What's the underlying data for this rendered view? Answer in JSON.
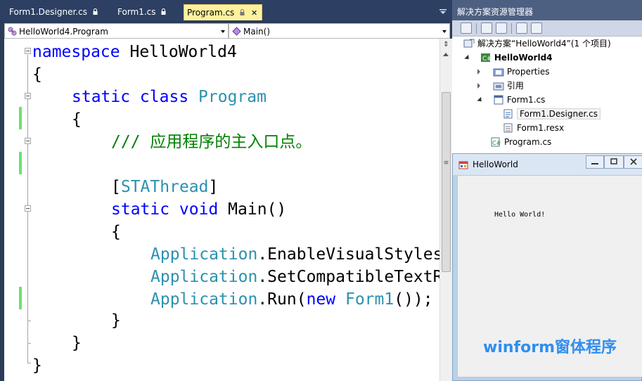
{
  "tabs": [
    {
      "label": "Form1.Designer.cs",
      "active": false
    },
    {
      "label": "Form1.cs",
      "active": false
    },
    {
      "label": "Program.cs",
      "active": true
    }
  ],
  "nav": {
    "type_combo": "HelloWorld4.Program",
    "member_combo": "Main()"
  },
  "code": {
    "l1_kw": "namespace",
    "l1_name": " HelloWorld4",
    "l2": "{",
    "l3_kw": "static class",
    "l3_type": "Program",
    "l4": "{",
    "l5_comment": "/// 应用程序的主入口点。",
    "l6_attr_open": "[",
    "l6_attr": "STAThread",
    "l6_attr_close": "]",
    "l7_kw": "static void",
    "l7_rest": " Main()",
    "l8": "{",
    "l9_type": "Application",
    "l9_rest": ".EnableVisualStyles",
    "l10_type": "Application",
    "l10_rest": ".SetCompatibleTextR",
    "l11_type": "Application",
    "l11_rest1": ".Run(",
    "l11_kw": "new",
    "l11_space": " ",
    "l11_type2": "Form1",
    "l11_rest2": "());",
    "l12": "}",
    "l13": "}",
    "l14": "}"
  },
  "solution_explorer": {
    "title": "解决方案资源管理器",
    "solution": "解决方案“HelloWorld4”(1 个项目)",
    "project": "HelloWorld4",
    "items": [
      "Properties",
      "引用",
      "Form1.cs",
      "Form1.Designer.cs",
      "Form1.resx",
      "Program.cs"
    ]
  },
  "form_window": {
    "title": "HelloWorld",
    "label": "Hello World!"
  },
  "caption": "winform窗体程序",
  "colors": {
    "keyword": "#0000ff",
    "type": "#2b91af",
    "comment": "#008000",
    "caption": "#2f8ef0",
    "active_tab": "#fff29d"
  }
}
